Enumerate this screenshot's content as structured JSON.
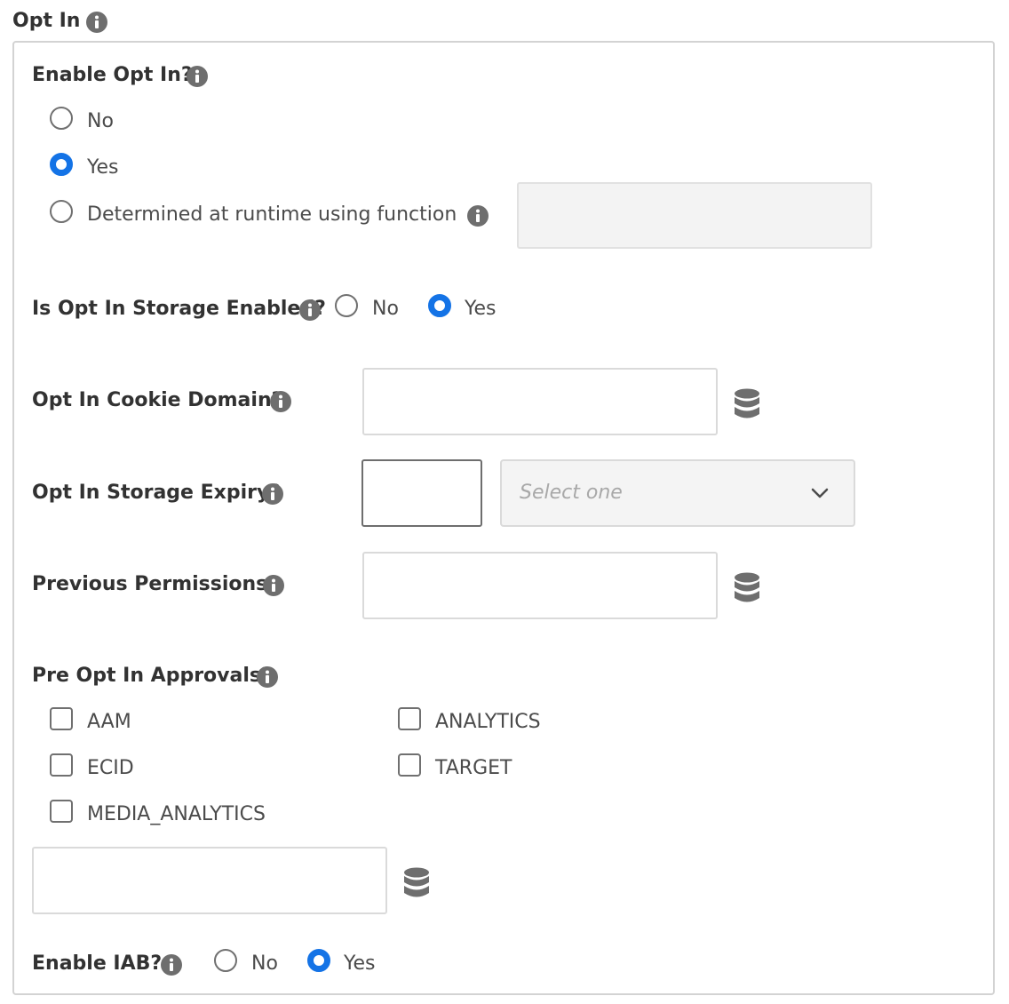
{
  "section": {
    "title": "Opt In"
  },
  "enable_opt_in": {
    "label": "Enable Opt In?",
    "options": [
      "No",
      "Yes",
      "Determined at runtime using function"
    ],
    "selected": "Yes"
  },
  "storage_enabled": {
    "label": "Is Opt In Storage Enabled?",
    "options": [
      "No",
      "Yes"
    ],
    "selected": "Yes"
  },
  "cookie_domain": {
    "label": "Opt In Cookie Domain?",
    "value": ""
  },
  "storage_expiry": {
    "label": "Opt In Storage Expiry?",
    "value": "",
    "select_placeholder": "Select one"
  },
  "previous_permissions": {
    "label": "Previous Permissions?",
    "value": ""
  },
  "pre_approvals": {
    "label": "Pre Opt In Approvals?",
    "options": [
      "AAM",
      "ANALYTICS",
      "ECID",
      "TARGET",
      "MEDIA_ANALYTICS"
    ],
    "checked": [],
    "value": ""
  },
  "enable_iab": {
    "label": "Enable IAB?",
    "options": [
      "No",
      "Yes"
    ],
    "selected": "Yes"
  },
  "colors": {
    "accent": "#1473e6",
    "info_icon": "#6e6e6e",
    "border": "#d3d3d3"
  },
  "icons": {
    "info": "info-icon",
    "data_element": "database-icon",
    "dropdown": "chevron-down-icon"
  }
}
